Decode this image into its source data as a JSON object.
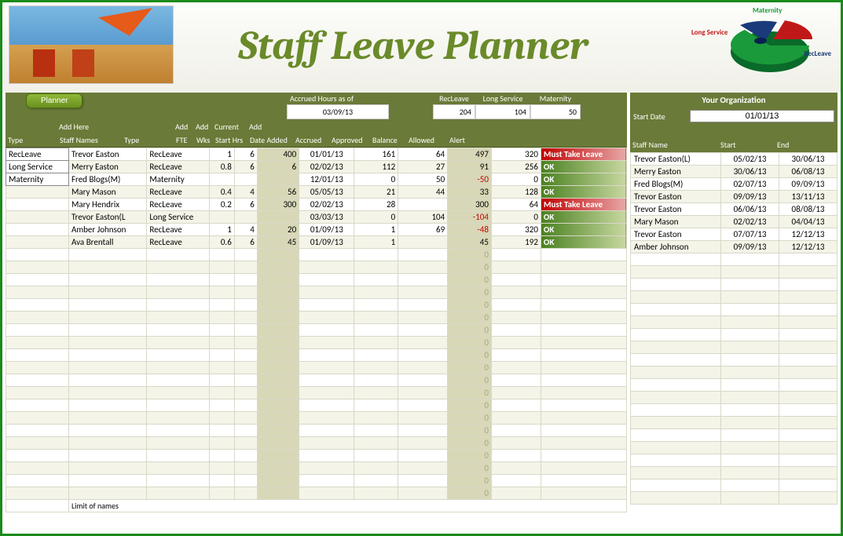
{
  "title": "Staff Leave Planner",
  "planner_button": "Planner",
  "summary": {
    "accrued_label": "Accrued Hours as of",
    "accrued_date": "03/09/13",
    "recleave_label": "RecLeave",
    "recleave_val": "204",
    "longservice_label": "Long Service",
    "longservice_val": "104",
    "maternity_label": "Maternity",
    "maternity_val": "50"
  },
  "sub_headers": {
    "add_here": "Add Here",
    "add1": "Add",
    "add2": "Add",
    "current": "Current",
    "add3": "Add"
  },
  "columns": {
    "type": "Type",
    "staff_names": "Staff Names",
    "type2": "Type",
    "fte": "FTE",
    "wks": "Wks",
    "start_hrs": "Start Hrs",
    "date_added": "Date Added",
    "accrued": "Accrued",
    "approved": "Approved",
    "balance": "Balance",
    "allowed": "Allowed",
    "alert": "Alert"
  },
  "type_list": [
    "RecLeave",
    "Long Service",
    "Maternity"
  ],
  "rows": [
    {
      "name": "Trevor Easton",
      "type": "RecLeave",
      "fte": "1",
      "wks": "6",
      "start": "400",
      "date": "01/01/13",
      "accrued": "161",
      "approved": "64",
      "balance": "497",
      "allowed": "320",
      "alert": "Must Take Leave",
      "alert_cls": "alert-red"
    },
    {
      "name": "Merry Easton",
      "type": "RecLeave",
      "fte": "0.8",
      "wks": "6",
      "start": "6",
      "date": "02/02/13",
      "accrued": "112",
      "approved": "27",
      "balance": "91",
      "allowed": "256",
      "alert": "OK",
      "alert_cls": "alert-ok"
    },
    {
      "name": "Fred Blogs(M)",
      "type": "Maternity",
      "fte": "",
      "wks": "",
      "start": "",
      "date": "12/01/13",
      "accrued": "0",
      "approved": "50",
      "balance": "-50",
      "allowed": "0",
      "alert": "OK",
      "alert_cls": "alert-ok"
    },
    {
      "name": "Mary Mason",
      "type": "RecLeave",
      "fte": "0.4",
      "wks": "4",
      "start": "56",
      "date": "05/05/13",
      "accrued": "21",
      "approved": "44",
      "balance": "33",
      "allowed": "128",
      "alert": "OK",
      "alert_cls": "alert-ok"
    },
    {
      "name": "Mary Hendrix",
      "type": "RecLeave",
      "fte": "0.2",
      "wks": "6",
      "start": "300",
      "date": "02/02/13",
      "accrued": "28",
      "approved": "",
      "balance": "300",
      "allowed": "64",
      "alert": "Must Take Leave",
      "alert_cls": "alert-red"
    },
    {
      "name": "Trevor Easton(L",
      "type": "Long Service",
      "fte": "",
      "wks": "",
      "start": "",
      "date": "03/03/13",
      "accrued": "0",
      "approved": "104",
      "balance": "-104",
      "allowed": "0",
      "alert": "OK",
      "alert_cls": "alert-ok"
    },
    {
      "name": "Amber Johnson",
      "type": "RecLeave",
      "fte": "1",
      "wks": "4",
      "start": "20",
      "date": "01/09/13",
      "accrued": "1",
      "approved": "69",
      "balance": "-48",
      "allowed": "320",
      "alert": "OK",
      "alert_cls": "alert-ok"
    },
    {
      "name": "Ava Brentall",
      "type": "RecLeave",
      "fte": "0.6",
      "wks": "6",
      "start": "45",
      "date": "01/09/13",
      "accrued": "1",
      "approved": "",
      "balance": "45",
      "allowed": "192",
      "alert": "OK",
      "alert_cls": "alert-ok"
    }
  ],
  "empty_main_rows": 20,
  "limit_label": "Limit of names",
  "org": {
    "header": "Your Organization",
    "start_date_label": "Start Date",
    "start_date": "01/01/13"
  },
  "side_columns": {
    "name": "Staff Name",
    "start": "Start",
    "end": "End"
  },
  "side_rows": [
    {
      "name": "Trevor Easton(L)",
      "start": "05/02/13",
      "end": "30/06/13"
    },
    {
      "name": "Merry Easton",
      "start": "30/06/13",
      "end": "06/08/13"
    },
    {
      "name": "Fred Blogs(M)",
      "start": "02/07/13",
      "end": "09/09/13"
    },
    {
      "name": "Trevor Easton",
      "start": "09/09/13",
      "end": "13/11/13"
    },
    {
      "name": "Trevor Easton",
      "start": "06/06/13",
      "end": "08/08/13"
    },
    {
      "name": "Mary Mason",
      "start": "02/02/13",
      "end": "04/04/13"
    },
    {
      "name": "Trevor Easton",
      "start": "07/07/13",
      "end": "12/12/13"
    },
    {
      "name": "Amber Johnson",
      "start": "09/09/13",
      "end": "12/12/13"
    }
  ],
  "empty_side_rows": 20,
  "chart_data": {
    "type": "pie",
    "title": "",
    "series": [
      {
        "name": "RecLeave",
        "value": 204,
        "color": "#1a9a3a"
      },
      {
        "name": "Long Service",
        "value": 104,
        "color": "#1a3a7a"
      },
      {
        "name": "Maternity",
        "value": 50,
        "color": "#c01818"
      }
    ]
  },
  "pie_labels": {
    "mat": "Maternity",
    "long": "Long Service",
    "rec": "RecLeave"
  }
}
